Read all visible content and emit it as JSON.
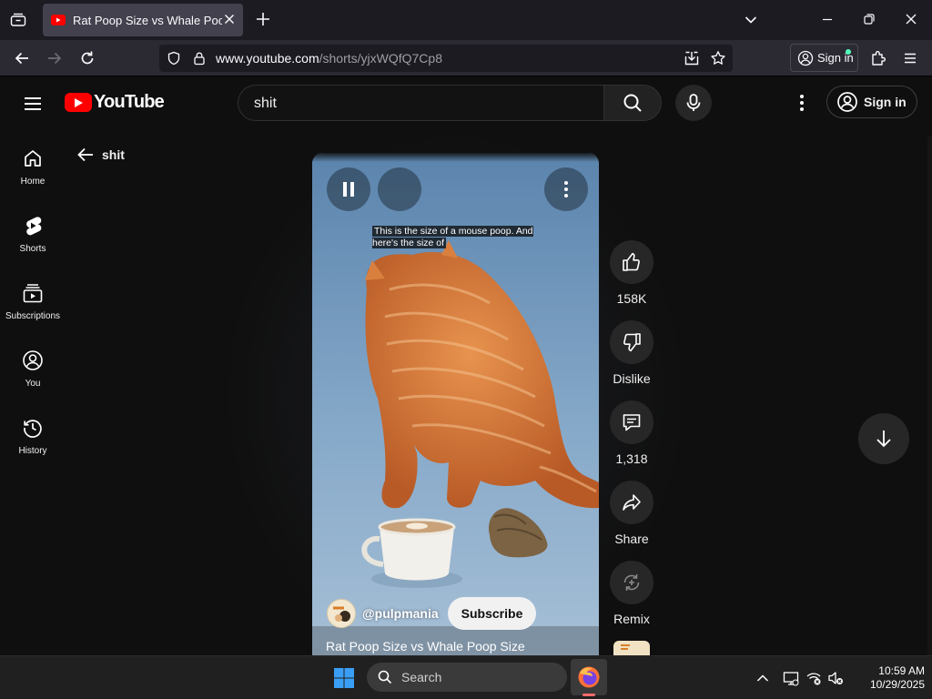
{
  "browser": {
    "tab_title": "Rat Poop Size vs Whale Poop Si",
    "url_host": "www.youtube.com",
    "url_path": "/shorts/yjxWQfQ7Cp8",
    "signin_label": "Sign in"
  },
  "youtube": {
    "logo_text": "YouTube",
    "search_query": "shit",
    "signin_label": "Sign in",
    "back_filter_label": "shit"
  },
  "guide": {
    "items": [
      {
        "label": "Home",
        "icon": "home-icon"
      },
      {
        "label": "Shorts",
        "icon": "shorts-icon"
      },
      {
        "label": "Subscriptions",
        "icon": "subscriptions-icon"
      },
      {
        "label": "You",
        "icon": "you-icon"
      },
      {
        "label": "History",
        "icon": "history-icon"
      }
    ]
  },
  "short": {
    "caption": "This is the size of a mouse poop. And here's the size of",
    "channel_handle": "@pulpmania",
    "subscribe_label": "Subscribe",
    "title": "Rat Poop Size vs Whale Poop Size"
  },
  "actions": {
    "like_count": "158K",
    "dislike_label": "Dislike",
    "comment_count": "1,318",
    "share_label": "Share",
    "remix_label": "Remix"
  },
  "taskbar": {
    "search_label": "Search",
    "time": "10:59 AM",
    "date": "10/29/2025"
  },
  "colors": {
    "youtube_red": "#ff0000",
    "background": "#0f0f0f",
    "chip": "#272727"
  }
}
